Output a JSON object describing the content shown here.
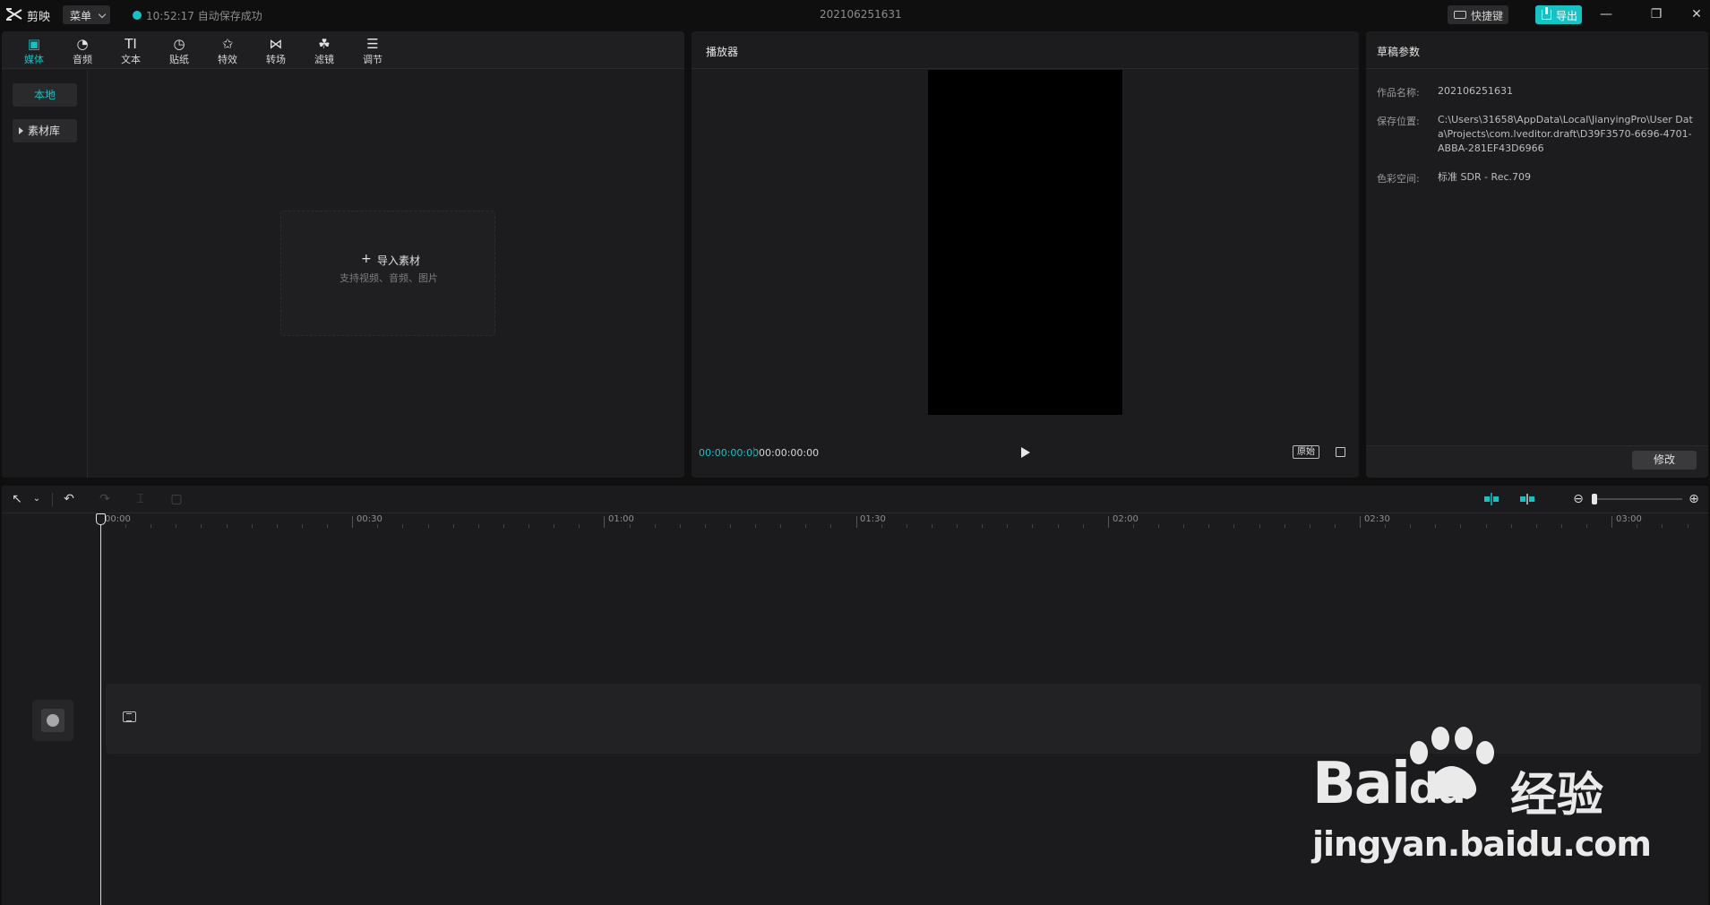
{
  "titlebar": {
    "app_name": "剪映",
    "menu_label": "菜单",
    "save_time": "10:52:17",
    "save_status": "自动保存成功",
    "project_title": "202106251631",
    "shortcut_label": "快捷键",
    "export_label": "导出",
    "accent_color": "#18c1c4"
  },
  "media": {
    "tabs": [
      {
        "label": "媒体",
        "icon": "media-icon"
      },
      {
        "label": "音频",
        "icon": "audio-icon"
      },
      {
        "label": "文本",
        "icon": "text-icon",
        "glyph": "TI"
      },
      {
        "label": "贴纸",
        "icon": "sticker-icon"
      },
      {
        "label": "特效",
        "icon": "effects-icon"
      },
      {
        "label": "转场",
        "icon": "transition-icon"
      },
      {
        "label": "滤镜",
        "icon": "filter-icon"
      },
      {
        "label": "调节",
        "icon": "adjust-icon"
      }
    ],
    "active_tab": "媒体",
    "sidebar": {
      "local": "本地",
      "library": "素材库"
    },
    "import": {
      "title": "导入素材",
      "subtitle": "支持视频、音频、图片"
    }
  },
  "player": {
    "title": "播放器",
    "current_time": "00:00:00:00",
    "total_time": "00:00:00:00",
    "ratio_label": "原始"
  },
  "draft": {
    "title": "草稿参数",
    "name_label": "作品名称:",
    "name_value": "202106251631",
    "path_label": "保存位置:",
    "path_value": "C:\\Users\\31658\\AppData\\Local\\JianyingPro\\User Data\\Projects\\com.lveditor.draft\\D39F3570-6696-4701-ABBA-281EF43D6966",
    "color_label": "色彩空间:",
    "color_value": "标准 SDR - Rec.709",
    "modify_label": "修改"
  },
  "timeline": {
    "ruler": [
      "00:00",
      "00:30",
      "01:00",
      "01:30",
      "02:00",
      "02:30",
      "03:00"
    ]
  },
  "watermark": {
    "brand": "Bai",
    "brand_tail": "du",
    "cn": "经验",
    "url": "jingyan.baidu.com"
  }
}
